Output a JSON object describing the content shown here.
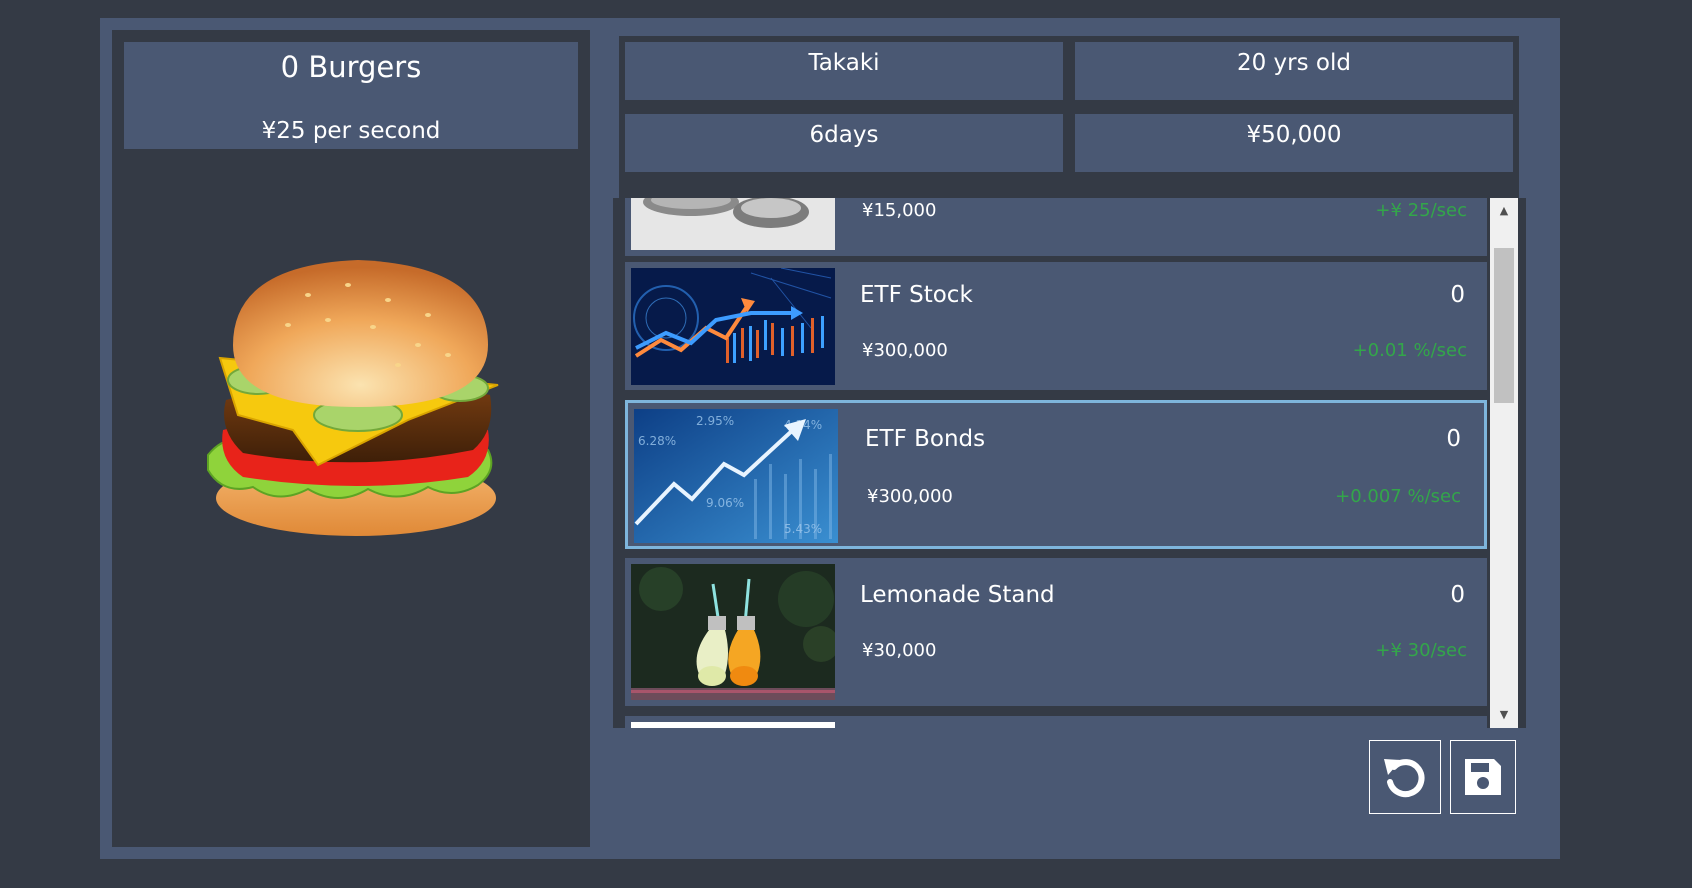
{
  "stats": {
    "burgers": "0 Burgers",
    "rate": "¥25 per second"
  },
  "player": {
    "name": "Takaki",
    "age": "20 yrs old",
    "days": "6days",
    "money": "¥50,000"
  },
  "items": [
    {
      "name": "",
      "price": "¥15,000",
      "owned": "",
      "income": "+¥ 25/sec"
    },
    {
      "name": "ETF Stock",
      "price": "¥300,000",
      "owned": "0",
      "income": "+0.01 %/sec"
    },
    {
      "name": "ETF Bonds",
      "price": "¥300,000",
      "owned": "0",
      "income": "+0.007 %/sec"
    },
    {
      "name": "Lemonade Stand",
      "price": "¥30,000",
      "owned": "0",
      "income": "+¥ 30/sec"
    }
  ],
  "thumb_text": {
    "bonds_a": "2.95%",
    "bonds_b": "6.28%",
    "bonds_c": "4.14%",
    "bonds_d": "9.06%",
    "bonds_e": "5.43%"
  },
  "icons": {
    "reset": "undo-icon",
    "save": "floppy-disk-icon"
  },
  "colors": {
    "background": "#343a45",
    "panel": "#4a5873",
    "income_green": "#33a64a",
    "selected_outline": "#7eb5dc"
  }
}
